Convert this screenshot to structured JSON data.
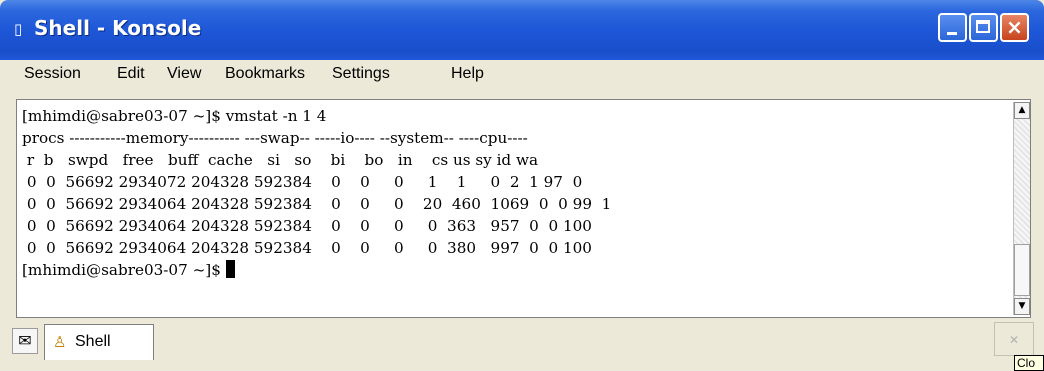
{
  "window": {
    "title": "Shell - Konsole",
    "app_icon": "konsole-icon",
    "controls": {
      "minimize": "minimize-icon",
      "maximize": "maximize-icon",
      "close": "×"
    }
  },
  "menubar": {
    "items": [
      "Session",
      "Edit",
      "View",
      "Bookmarks",
      "Settings",
      "Help"
    ]
  },
  "terminal": {
    "lines": [
      "[mhimdi@sabre03-07 ~]$ vmstat -n 1 4",
      "procs -----------memory---------- ---swap-- -----io---- --system-- ----cpu----",
      " r  b   swpd   free   buff  cache   si   so    bi    bo   in    cs us sy id wa",
      " 0  0  56692 2934072 204328 592384    0    0     0     1    1     0  2  1 97  0",
      " 0  0  56692 2934064 204328 592384    0    0     0    20  460  1069  0  0 99  1",
      " 0  0  56692 2934064 204328 592384    0    0     0     0  363   957  0  0 100",
      " 0  0  56692 2934064 204328 592384    0    0     0     0  380   997  0  0 100"
    ],
    "prompt": "[mhimdi@sabre03-07 ~]$ "
  },
  "scrollbar": {
    "up": "▲",
    "down": "▼"
  },
  "tabbar": {
    "tabs": [
      {
        "label": "Shell",
        "icon": "shell-icon"
      }
    ],
    "new_tab_icon": "new-session-icon",
    "close_icon": "close-tab-icon"
  },
  "tooltip": {
    "text": "Clo"
  }
}
